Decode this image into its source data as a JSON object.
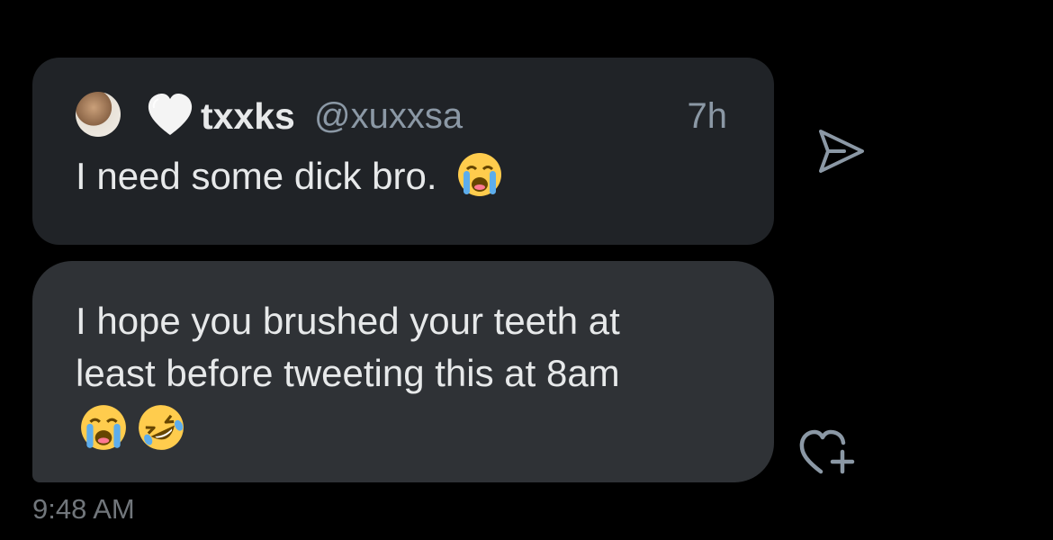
{
  "quoted_post": {
    "author_name": "txxks",
    "author_handle": "@xuxxsa",
    "time_ago": "7h",
    "text": "I need some dick bro.",
    "emoji": "loudly-crying-face",
    "name_icon": "white-heart-icon"
  },
  "reply_message": {
    "line1": "I hope you brushed your teeth at",
    "line2": "least before tweeting this at 8am",
    "emojis": [
      "loudly-crying-face",
      "rolling-on-floor-laughing-face"
    ]
  },
  "actions": {
    "send_icon": "send-icon",
    "like_icon": "heart-plus-icon"
  },
  "message_time": "9:48 AM",
  "colors": {
    "background": "#000000",
    "quote_card": "#202327",
    "reply_bubble": "#2f3236",
    "primary_text": "#e7e9ea",
    "secondary_text": "#8b98a5",
    "timestamp": "#71767b"
  }
}
